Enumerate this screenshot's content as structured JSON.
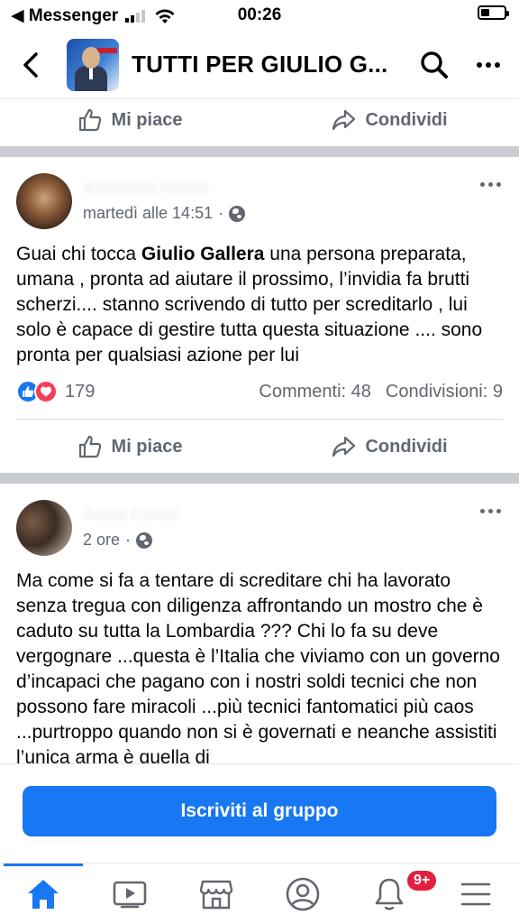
{
  "status_bar": {
    "back_app": "◀ Messenger",
    "time": "00:26"
  },
  "header": {
    "title": "TUTTI PER GIULIO G...",
    "icons": [
      "chevron-left-icon",
      "search-icon",
      "more-icon"
    ]
  },
  "top_actions": {
    "like_label": "Mi piace",
    "share_label": "Condividi"
  },
  "posts": [
    {
      "author": "Anonima Nome",
      "timestamp": "martedì alle 14:51",
      "visibility": "public",
      "text_before": "Guai chi tocca ",
      "text_bold": "Giulio Gallera",
      "text_after": " una persona preparata, umana , pronta ad aiutare il prossimo, l’invidia fa brutti scherzi.... stanno scrivendo di tutto per screditarlo , lui solo è capace di gestire tutta questa situazione .... sono pronta per qualsiasi azione per lui",
      "reactions_count": "179",
      "comments": "Commenti: 48",
      "shares": "Condivisioni: 9",
      "like_label": "Mi piace",
      "share_label": "Condividi"
    },
    {
      "author": "Anna Cerati",
      "timestamp": "2 ore",
      "visibility": "public",
      "text": "Ma come si fa a tentare di screditare chi ha lavorato senza tregua con diligenza affrontando un mostro che è caduto su tutta la Lombardia ??? Chi lo fa su deve vergognare ...questa è l’Italia che viviamo con un governo d’incapaci che pagano con i nostri soldi tecnici che non possono fare miracoli ...più tecnici fantomatici più caos ...purtroppo quando non si è governati e neanche assistiti l’unica arma è quella di"
    }
  ],
  "join_button": {
    "label": "Iscriviti al gruppo"
  },
  "tabbar": {
    "tabs": [
      "home-icon",
      "video-icon",
      "marketplace-icon",
      "profile-icon",
      "notifications-icon",
      "menu-icon"
    ],
    "notifications_badge": "9+"
  },
  "colors": {
    "accent": "#1877f2",
    "secondary_text": "#606770",
    "badge": "#e41e3f",
    "separator": "#c9ccd1"
  }
}
